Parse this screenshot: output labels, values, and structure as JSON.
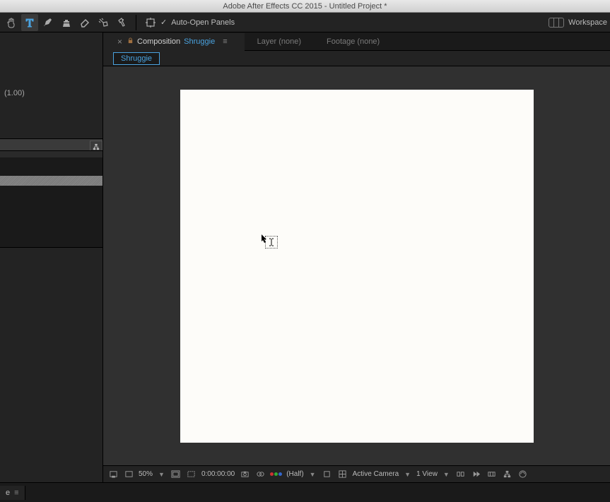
{
  "titlebar": "Adobe After Effects CC 2015 - Untitled Project *",
  "toolstrip": {
    "auto_open": "Auto-Open Panels",
    "workspace": "Workspace"
  },
  "left": {
    "gamma": "(1.00)"
  },
  "viewer": {
    "tabs": {
      "comp_kind": "Composition",
      "comp_name": "Shruggie",
      "layer": "Layer (none)",
      "footage": "Footage (none)"
    },
    "subtab": "Shruggie"
  },
  "footer": {
    "zoom": "50%",
    "timecode": "0:00:00:00",
    "resolution": "(Half)",
    "camera": "Active Camera",
    "views": "1 View"
  },
  "timeline": {
    "tab_suffix": "e"
  }
}
